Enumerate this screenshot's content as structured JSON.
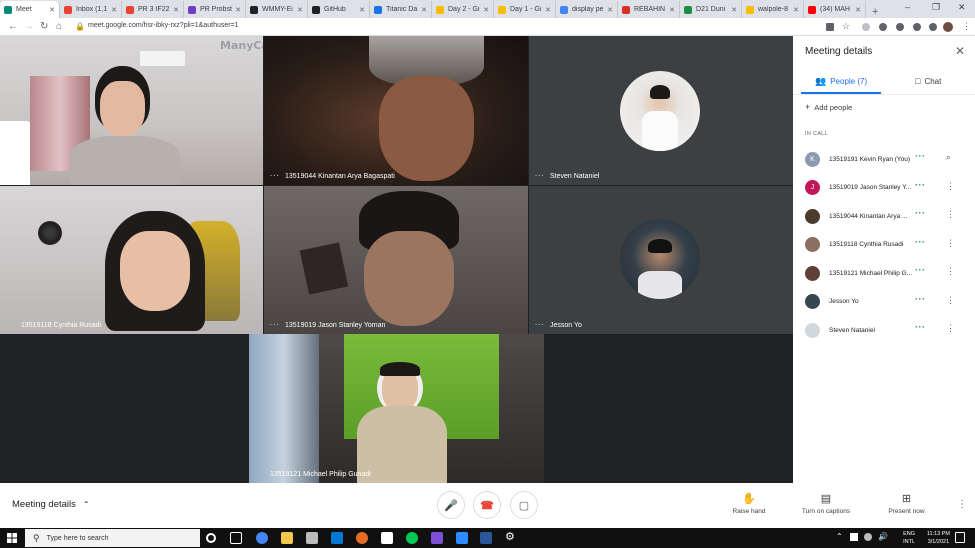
{
  "browser": {
    "tabs": [
      {
        "label": "Meet",
        "color": "#00897b",
        "active": true
      },
      {
        "label": "Inbox (1,1",
        "color": "#ea4335"
      },
      {
        "label": "PR 3 IF22",
        "color": "#ea4335"
      },
      {
        "label": "PR Probst",
        "color": "#6f42c1"
      },
      {
        "label": "WMMY-Ei",
        "color": "#202124"
      },
      {
        "label": "GitHub",
        "color": "#202124"
      },
      {
        "label": "Titanic Da",
        "color": "#1a73e8"
      },
      {
        "label": "Day 2 - Gi",
        "color": "#fbbc04"
      },
      {
        "label": "Day 1 - Gi",
        "color": "#fbbc04"
      },
      {
        "label": "display pe",
        "color": "#4285f4"
      },
      {
        "label": "REBAHIN",
        "color": "#d93025"
      },
      {
        "label": "D21 Duni",
        "color": "#1e8e3e"
      },
      {
        "label": "walpole-8",
        "color": "#fbbc04"
      },
      {
        "label": "(34) MAH",
        "color": "#ff0000"
      }
    ],
    "url": "meet.google.com/hsr-ibky-rxz?pli=1&authuser=1"
  },
  "tiles": [
    {
      "name": "",
      "watermark": "ManyCam"
    },
    {
      "name": "13519044 Kinantan Arya Bagaspati"
    },
    {
      "name": "Steven Nataniel"
    },
    {
      "name": "13519118 Cynthia Rusadi"
    },
    {
      "name": "13519019 Jason Stanley Yoman"
    },
    {
      "name": "Jesson Yo"
    },
    {
      "name": "13519121 Michael Philip Gunadi"
    }
  ],
  "panel": {
    "title": "Meeting details",
    "people_tab": "People (7)",
    "chat_tab": "Chat",
    "add_people": "Add people",
    "in_call": "IN CALL",
    "people": [
      {
        "name": "13519191 Kevin Ryan (You)",
        "initial": "K",
        "color": "#8a9bb0"
      },
      {
        "name": "13519019 Jason Stanley Y...",
        "initial": "J",
        "color": "#c2185b"
      },
      {
        "name": "13519044 Kinantan Arya ...",
        "initial": "",
        "color": "#4a3b2c"
      },
      {
        "name": "13519118 Cynthia Rusadi",
        "initial": "",
        "color": "#8d6e63"
      },
      {
        "name": "13519121 Michael Philip G...",
        "initial": "",
        "color": "#5d4037"
      },
      {
        "name": "Jesson Yo",
        "initial": "",
        "color": "#37474f"
      },
      {
        "name": "Steven Nataniel",
        "initial": "",
        "color": "#cfd8dc"
      }
    ]
  },
  "controls": {
    "meeting_details": "Meeting details",
    "raise_hand": "Raise hand",
    "captions": "Turn on captions",
    "present": "Present now"
  },
  "taskbar": {
    "search_placeholder": "Type here to search",
    "lang": "ENG",
    "region": "INTL",
    "time": "11:13 PM",
    "date": "3/1/2021"
  }
}
